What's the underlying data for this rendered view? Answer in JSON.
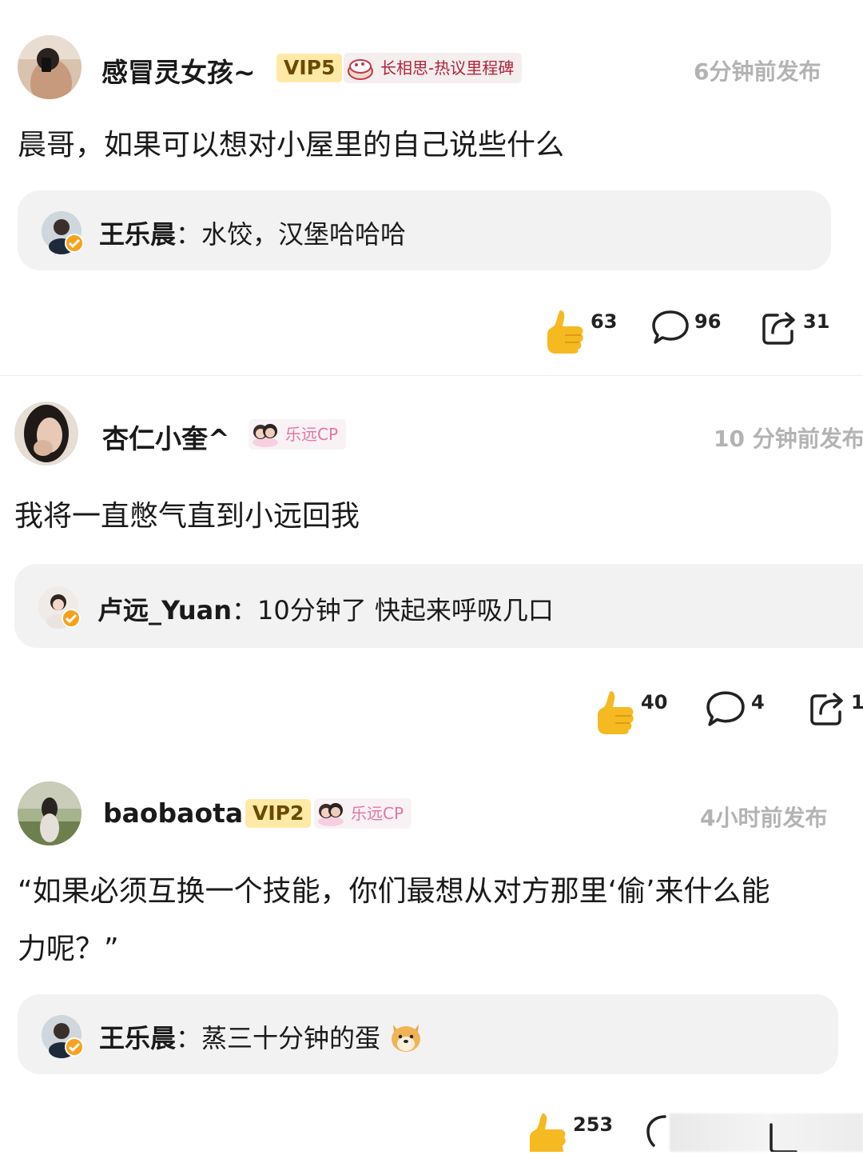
{
  "posts": [
    {
      "user": "感冒灵女孩~",
      "vip": "VIP5",
      "badge": "长相思-热议里程碑",
      "time": "6分钟前发布",
      "text": "晨哥，如果可以想对小屋里的自己说些什么",
      "reply": {
        "name": "王乐晨",
        "sep": "：",
        "text": "水饺，汉堡哈哈哈"
      },
      "likes": "63",
      "comments": "96",
      "shares": "31"
    },
    {
      "user": "杏仁小奎^",
      "badge": "乐远CP",
      "time": "10 分钟前发布",
      "text": "我将一直憋气直到小远回我",
      "reply": {
        "name": "卢远_Yuan",
        "sep": "：",
        "text": "10分钟了 快起来呼吸几口"
      },
      "likes": "40",
      "comments": "4",
      "shares": "1"
    },
    {
      "user": "baobaota",
      "vip": "VIP2",
      "badge": "乐远CP",
      "time": "4小时前发布",
      "text_line1": "“如果必须互换一个技能，你们最想从对方那里‘偷’来什么能",
      "text_line2": "力呢？”",
      "reply": {
        "name": "王乐晨",
        "sep": "：",
        "text": "蒸三十分钟的蛋"
      },
      "likes": "253"
    }
  ],
  "colors": {
    "vip_bg": "#ffe9a6",
    "thumb": "#f5b921",
    "badge_pink": "#e573a7",
    "time": "#b3b3b3",
    "reply_bg": "#f2f2f2",
    "verified": "#f7a21b"
  },
  "icons": [
    "thumbs-up-icon",
    "comment-icon",
    "share-icon",
    "verified-icon",
    "emoji-dog-icon"
  ]
}
